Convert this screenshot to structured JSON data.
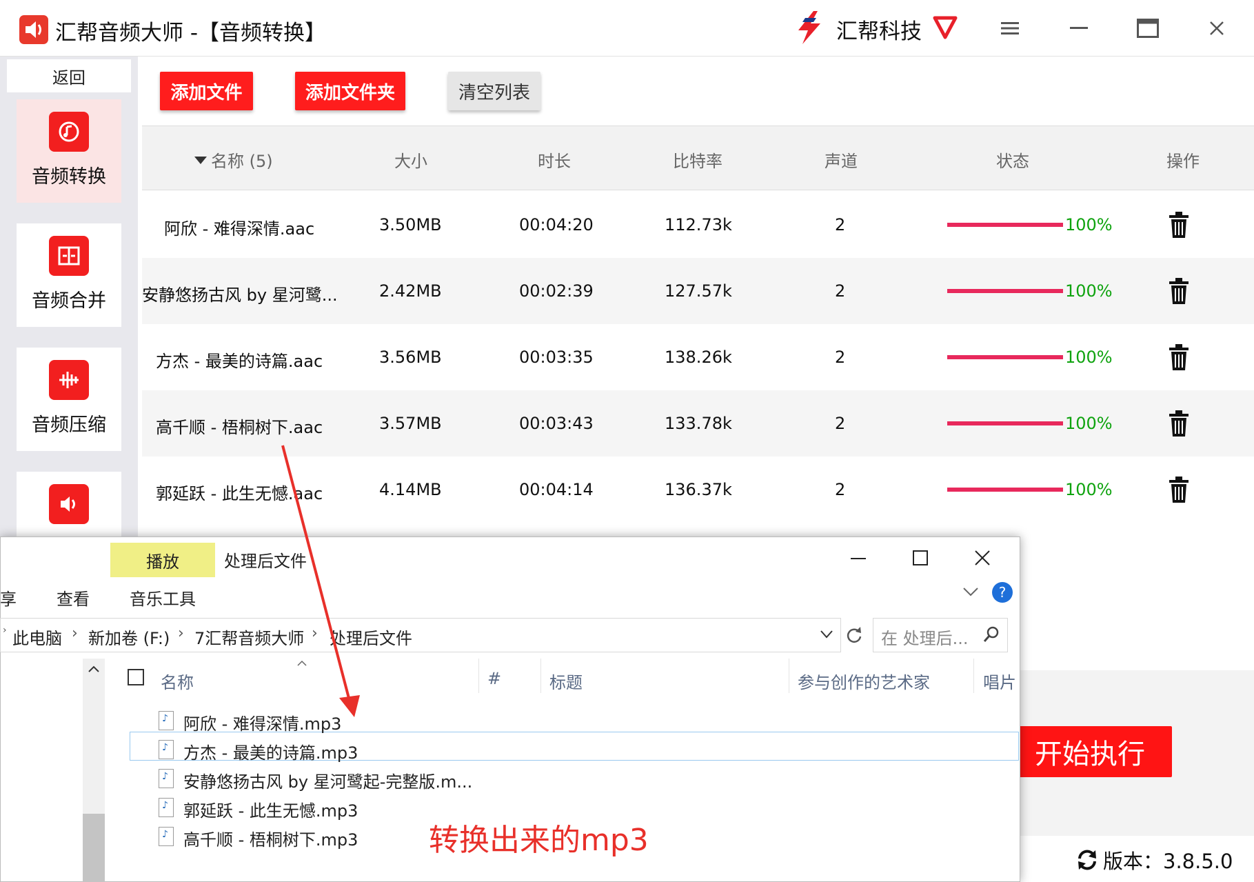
{
  "titlebar": {
    "app_title": "汇帮音频大师  -【音频转换】",
    "brand": "汇帮科技"
  },
  "sidebar": {
    "back": "返回",
    "items": [
      {
        "label": "音频转换",
        "icon": "audio-convert-icon",
        "active": true
      },
      {
        "label": "音频合并",
        "icon": "audio-merge-icon",
        "active": false
      },
      {
        "label": "音频压缩",
        "icon": "audio-compress-icon",
        "active": false
      },
      {
        "label": "",
        "icon": "audio-volume-icon",
        "active": false
      }
    ]
  },
  "toolbar": {
    "add_file": "添加文件",
    "add_folder": "添加文件夹",
    "clear_list": "清空列表"
  },
  "table": {
    "headers": {
      "name": "名称 (5)",
      "size": "大小",
      "duration": "时长",
      "bitrate": "比特率",
      "channels": "声道",
      "status": "状态",
      "action": "操作"
    },
    "rows": [
      {
        "name": "阿欣 - 难得深情.aac",
        "size": "3.50MB",
        "duration": "00:04:20",
        "bitrate": "112.73k",
        "channels": "2",
        "progress": "100%"
      },
      {
        "name": "安静悠扬古风 by 星河鹭...",
        "size": "2.42MB",
        "duration": "00:02:39",
        "bitrate": "127.57k",
        "channels": "2",
        "progress": "100%"
      },
      {
        "name": "方杰 - 最美的诗篇.aac",
        "size": "3.56MB",
        "duration": "00:03:35",
        "bitrate": "138.26k",
        "channels": "2",
        "progress": "100%"
      },
      {
        "name": "高千顺 - 梧桐树下.aac",
        "size": "3.57MB",
        "duration": "00:03:43",
        "bitrate": "133.78k",
        "channels": "2",
        "progress": "100%"
      },
      {
        "name": "郭延跃 - 此生无憾.aac",
        "size": "4.14MB",
        "duration": "00:04:14",
        "bitrate": "136.37k",
        "channels": "2",
        "progress": "100%"
      }
    ]
  },
  "explorer": {
    "play_tab": "播放",
    "window_title": "处理后文件",
    "ribbon": {
      "share": "享",
      "view": "查看",
      "music_tools": "音乐工具"
    },
    "breadcrumb": [
      "此电脑",
      "新加卷 (F:)",
      "7汇帮音频大师",
      "处理后文件"
    ],
    "search_placeholder": "在 处理后...",
    "columns": {
      "name": "名称",
      "number": "#",
      "title": "标题",
      "artist": "参与创作的艺术家",
      "album": "唱片"
    },
    "files": [
      "阿欣 - 难得深情.mp3",
      "方杰 - 最美的诗篇.mp3",
      "安静悠扬古风 by 星河鹭起-完整版.m...",
      "郭延跃 - 此生无憾.mp3",
      "高千顺 - 梧桐树下.mp3"
    ]
  },
  "annotation": "转换出来的mp3",
  "start_button": "开始执行",
  "version_label": "版本：3.8.5.0",
  "colors": {
    "accent": "#ff1d1d",
    "progress": "#e8295c",
    "success_text": "#0fa30f",
    "annotation": "#e8302a"
  }
}
